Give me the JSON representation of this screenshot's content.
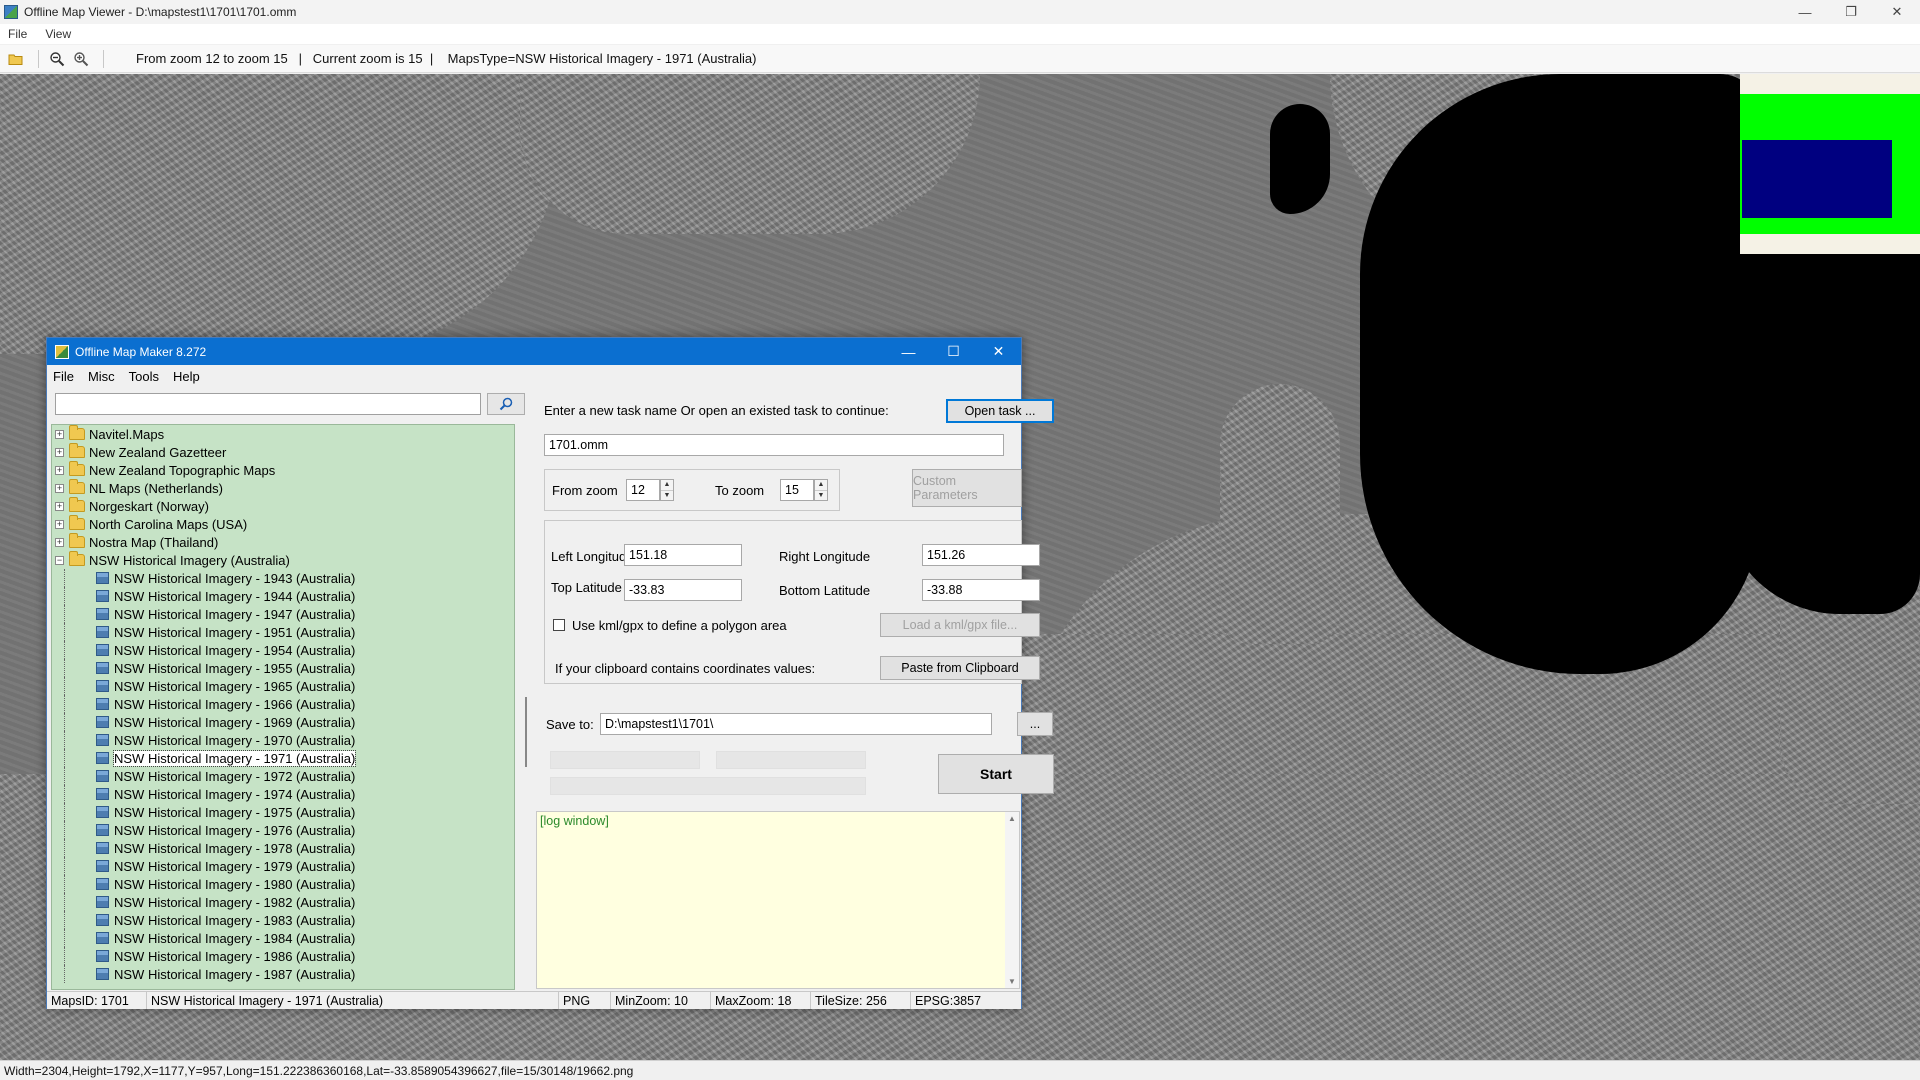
{
  "viewer": {
    "title": "Offline Map Viewer - D:\\mapstest1\\1701\\1701.omm",
    "menu": [
      "File",
      "View"
    ],
    "toolbar_status": "From zoom 12 to zoom 15   |   Current zoom is 15  |    MapsType=NSW Historical Imagery - 1971 (Australia)",
    "statusbar": "Width=2304,Height=1792,X=1177,Y=957,Long=151.222386360168,Lat=-33.8589054396627,file=15/30148/19662.png",
    "icons": [
      "folder-open-icon",
      "zoom-out-icon",
      "zoom-in-icon"
    ]
  },
  "dialog": {
    "title": "Offline Map Maker 8.272",
    "menu": [
      "File",
      "Misc",
      "Tools",
      "Help"
    ],
    "search": {
      "value": ""
    },
    "tree": {
      "folders": [
        {
          "label": "Navitel.Maps",
          "expanded": false
        },
        {
          "label": "New Zealand Gazetteer",
          "expanded": false
        },
        {
          "label": "New Zealand Topographic Maps",
          "expanded": false
        },
        {
          "label": "NL Maps (Netherlands)",
          "expanded": false
        },
        {
          "label": "Norgeskart (Norway)",
          "expanded": false
        },
        {
          "label": "North Carolina Maps (USA)",
          "expanded": false
        },
        {
          "label": "Nostra Map (Thailand)",
          "expanded": false
        },
        {
          "label": "NSW Historical Imagery (Australia)",
          "expanded": true
        }
      ],
      "children": [
        "NSW Historical Imagery - 1943 (Australia)",
        "NSW Historical Imagery - 1944 (Australia)",
        "NSW Historical Imagery - 1947 (Australia)",
        "NSW Historical Imagery - 1951 (Australia)",
        "NSW Historical Imagery - 1954 (Australia)",
        "NSW Historical Imagery - 1955 (Australia)",
        "NSW Historical Imagery - 1965 (Australia)",
        "NSW Historical Imagery - 1966 (Australia)",
        "NSW Historical Imagery - 1969 (Australia)",
        "NSW Historical Imagery - 1970 (Australia)",
        "NSW Historical Imagery - 1971 (Australia)",
        "NSW Historical Imagery - 1972 (Australia)",
        "NSW Historical Imagery - 1974 (Australia)",
        "NSW Historical Imagery - 1975 (Australia)",
        "NSW Historical Imagery - 1976 (Australia)",
        "NSW Historical Imagery - 1978 (Australia)",
        "NSW Historical Imagery - 1979 (Australia)",
        "NSW Historical Imagery - 1980 (Australia)",
        "NSW Historical Imagery - 1982 (Australia)",
        "NSW Historical Imagery - 1983 (Australia)",
        "NSW Historical Imagery - 1984 (Australia)",
        "NSW Historical Imagery - 1986 (Australia)",
        "NSW Historical Imagery - 1987 (Australia)"
      ],
      "selected": "NSW Historical Imagery - 1971 (Australia)"
    },
    "task": {
      "prompt": "Enter a new task name Or open an existed task to continue:",
      "open_button": "Open task ...",
      "name_value": "1701.omm"
    },
    "zoom": {
      "from_label": "From zoom",
      "from_value": "12",
      "to_label": "To zoom",
      "to_value": "15",
      "custom_button": "Custom Parameters"
    },
    "bounds": {
      "left_lon_label": "Left Longitude",
      "left_lon_value": "151.18",
      "right_lon_label": "Right Longitude",
      "right_lon_value": "151.26",
      "top_lat_label": "Top Latitude",
      "top_lat_value": "-33.83",
      "bottom_lat_label": "Bottom Latitude",
      "bottom_lat_value": "-33.88",
      "kml_checkbox_label": "Use kml/gpx to define a polygon area",
      "kml_checked": false,
      "load_kml_button": "Load a kml/gpx file...",
      "clipboard_label": "If your clipboard contains coordinates values:",
      "paste_button": "Paste from Clipboard"
    },
    "save": {
      "label": "Save to:",
      "path_value": "D:\\mapstest1\\1701\\",
      "browse_button": "..."
    },
    "start_button": "Start",
    "log_text": "[log window]",
    "status": {
      "maps_id": "MapsID: 1701",
      "map_name": "NSW Historical Imagery - 1971 (Australia)",
      "format": "PNG",
      "min_zoom": "MinZoom: 10",
      "max_zoom": "MaxZoom: 18",
      "tile_size": "TileSize: 256",
      "epsg": "EPSG:3857"
    }
  },
  "colors": {
    "dialog_title_bg": "#0b6fd0",
    "tree_bg": "#c6e3c6",
    "log_bg": "#ffffe0",
    "log_text": "#2b8a2b",
    "minimap_green": "#00ff00",
    "minimap_blue": "#000080"
  }
}
